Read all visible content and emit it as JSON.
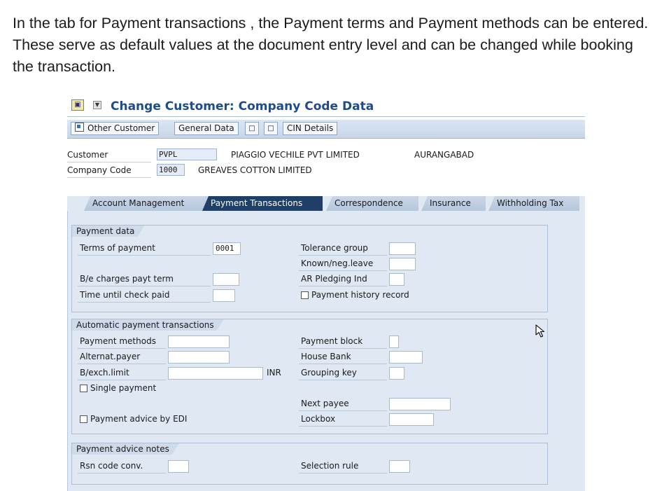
{
  "intro": {
    "text": "In the tab for Payment transactions , the Payment terms and Payment methods can be entered. These serve as default values at the document entry level and can be changed while booking the transaction."
  },
  "window": {
    "title": "Change Customer: Company Code Data"
  },
  "toolbar": {
    "other_customer": "Other Customer",
    "general_data": "General Data",
    "cin_details": "CIN Details"
  },
  "header": {
    "customer_label": "Customer",
    "customer_value": "PVPL",
    "customer_name": "PIAGGIO VECHILE PVT LIMITED",
    "customer_city": "AURANGABAD",
    "company_code_label": "Company Code",
    "company_code_value": "1000",
    "company_name": "GREAVES COTTON LIMITED"
  },
  "tabs": [
    {
      "label": "Account Management",
      "active": false
    },
    {
      "label": "Payment Transactions",
      "active": true
    },
    {
      "label": "Correspondence",
      "active": false
    },
    {
      "label": "Insurance",
      "active": false
    },
    {
      "label": "Withholding Tax",
      "active": false
    }
  ],
  "payment_data": {
    "title": "Payment data",
    "terms_of_payment_label": "Terms of payment",
    "terms_of_payment_value": "0001",
    "tolerance_group_label": "Tolerance group",
    "known_neg_leave_label": "Known/neg.leave",
    "be_charges_label": "B/e charges payt term",
    "ar_pledging_label": "AR Pledging Ind",
    "time_check_label": "Time until check paid",
    "payment_history_label": "Payment history record"
  },
  "automatic_payment": {
    "title": "Automatic payment transactions",
    "payment_methods_label": "Payment methods",
    "payment_block_label": "Payment block",
    "alternat_payer_label": "Alternat.payer",
    "house_bank_label": "House Bank",
    "bexch_limit_label": "B/exch.limit",
    "currency": "INR",
    "grouping_key_label": "Grouping key",
    "single_payment_label": "Single payment",
    "next_payee_label": "Next payee",
    "payment_advice_edi_label": "Payment advice by EDI",
    "lockbox_label": "Lockbox"
  },
  "payment_advice": {
    "title": "Payment advice notes",
    "rsn_code_label": "Rsn code conv.",
    "selection_rule_label": "Selection rule"
  },
  "icons": {
    "title_icon": "glasses-icon",
    "cursor": "mouse-pointer-icon"
  },
  "colors": {
    "title_text": "#1f4c87",
    "active_tab": "#1f3f66",
    "tab_body": "#dfe8f3"
  }
}
